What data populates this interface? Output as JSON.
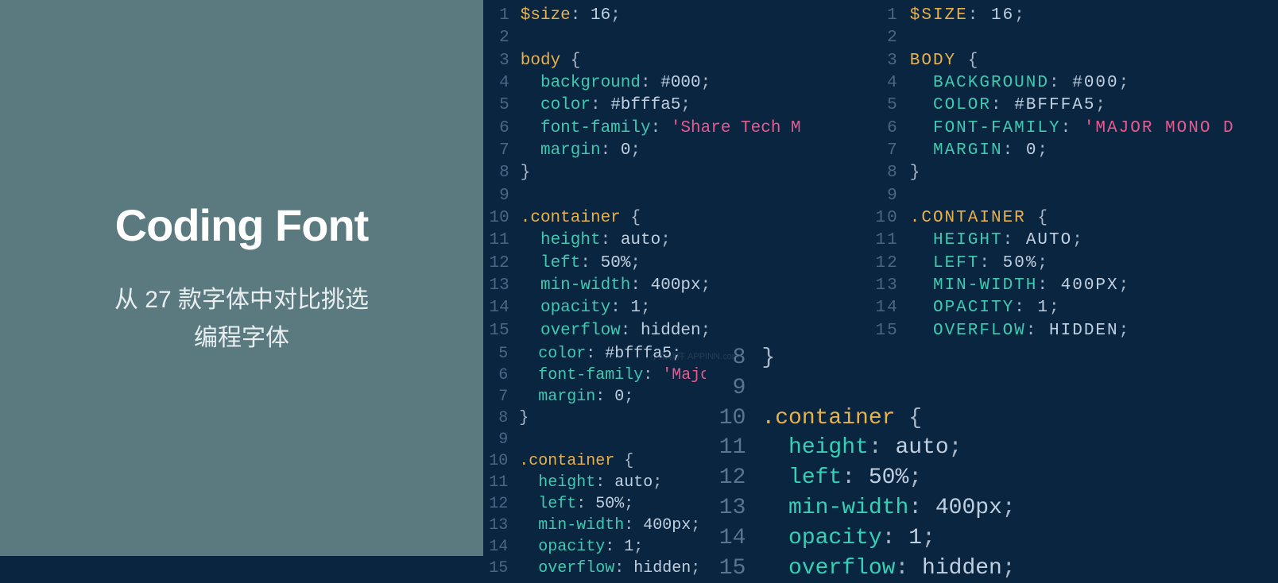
{
  "header": {
    "title": "Coding Font",
    "subtitle_line1": "从 27 款字体中对比挑选",
    "subtitle_line2": "编程字体"
  },
  "panes": {
    "a": {
      "lines": [
        {
          "n": "1",
          "t": [
            [
              "var",
              "$size"
            ],
            [
              "punc",
              ": "
            ],
            [
              "num",
              "16"
            ],
            [
              "punc",
              ";"
            ]
          ]
        },
        {
          "n": "2",
          "t": []
        },
        {
          "n": "3",
          "t": [
            [
              "var",
              "body"
            ],
            [
              "plain",
              " "
            ],
            [
              "punc",
              "{"
            ]
          ]
        },
        {
          "n": "4",
          "t": [
            [
              "plain",
              "  "
            ],
            [
              "prop",
              "background"
            ],
            [
              "punc",
              ": "
            ],
            [
              "num",
              "#000"
            ],
            [
              "punc",
              ";"
            ]
          ]
        },
        {
          "n": "5",
          "t": [
            [
              "plain",
              "  "
            ],
            [
              "prop",
              "color"
            ],
            [
              "punc",
              ": "
            ],
            [
              "num",
              "#bfffa5"
            ],
            [
              "punc",
              ";"
            ]
          ]
        },
        {
          "n": "6",
          "t": [
            [
              "plain",
              "  "
            ],
            [
              "prop",
              "font-family"
            ],
            [
              "punc",
              ": "
            ],
            [
              "str",
              "'Share Tech M"
            ]
          ]
        },
        {
          "n": "7",
          "t": [
            [
              "plain",
              "  "
            ],
            [
              "prop",
              "margin"
            ],
            [
              "punc",
              ": "
            ],
            [
              "num",
              "0"
            ],
            [
              "punc",
              ";"
            ]
          ]
        },
        {
          "n": "8",
          "t": [
            [
              "punc",
              "}"
            ]
          ]
        },
        {
          "n": "9",
          "t": []
        },
        {
          "n": "10",
          "t": [
            [
              "var",
              ".container"
            ],
            [
              "plain",
              " "
            ],
            [
              "punc",
              "{"
            ]
          ]
        },
        {
          "n": "11",
          "t": [
            [
              "plain",
              "  "
            ],
            [
              "prop",
              "height"
            ],
            [
              "punc",
              ": "
            ],
            [
              "num",
              "auto"
            ],
            [
              "punc",
              ";"
            ]
          ]
        },
        {
          "n": "12",
          "t": [
            [
              "plain",
              "  "
            ],
            [
              "prop",
              "left"
            ],
            [
              "punc",
              ": "
            ],
            [
              "num",
              "50%"
            ],
            [
              "punc",
              ";"
            ]
          ]
        },
        {
          "n": "13",
          "t": [
            [
              "plain",
              "  "
            ],
            [
              "prop",
              "min-width"
            ],
            [
              "punc",
              ": "
            ],
            [
              "num",
              "400px"
            ],
            [
              "punc",
              ";"
            ]
          ]
        },
        {
          "n": "14",
          "t": [
            [
              "plain",
              "  "
            ],
            [
              "prop",
              "opacity"
            ],
            [
              "punc",
              ": "
            ],
            [
              "num",
              "1"
            ],
            [
              "punc",
              ";"
            ]
          ]
        },
        {
          "n": "15",
          "t": [
            [
              "plain",
              "  "
            ],
            [
              "prop",
              "overflow"
            ],
            [
              "punc",
              ": "
            ],
            [
              "num",
              "hidden"
            ],
            [
              "punc",
              ";"
            ]
          ]
        }
      ]
    },
    "b": {
      "lines": [
        {
          "n": "1",
          "t": [
            [
              "var",
              "$SIZE"
            ],
            [
              "punc",
              ": "
            ],
            [
              "num",
              "16"
            ],
            [
              "punc",
              ";"
            ]
          ]
        },
        {
          "n": "2",
          "t": []
        },
        {
          "n": "3",
          "t": [
            [
              "var",
              "BODY"
            ],
            [
              "plain",
              " "
            ],
            [
              "punc",
              "{"
            ]
          ]
        },
        {
          "n": "4",
          "t": [
            [
              "plain",
              "  "
            ],
            [
              "prop",
              "BACKGROUND"
            ],
            [
              "punc",
              ": "
            ],
            [
              "num",
              "#000"
            ],
            [
              "punc",
              ";"
            ]
          ]
        },
        {
          "n": "5",
          "t": [
            [
              "plain",
              "  "
            ],
            [
              "prop",
              "COLOR"
            ],
            [
              "punc",
              ": "
            ],
            [
              "num",
              "#BFFFA5"
            ],
            [
              "punc",
              ";"
            ]
          ]
        },
        {
          "n": "6",
          "t": [
            [
              "plain",
              "  "
            ],
            [
              "prop",
              "FONT-FAMILY"
            ],
            [
              "punc",
              ": "
            ],
            [
              "str",
              "'MAJOR MONO D"
            ]
          ]
        },
        {
          "n": "7",
          "t": [
            [
              "plain",
              "  "
            ],
            [
              "prop",
              "MARGIN"
            ],
            [
              "punc",
              ": "
            ],
            [
              "num",
              "0"
            ],
            [
              "punc",
              ";"
            ]
          ]
        },
        {
          "n": "8",
          "t": [
            [
              "punc",
              "}"
            ]
          ]
        },
        {
          "n": "9",
          "t": []
        },
        {
          "n": "10",
          "t": [
            [
              "var",
              ".CONTAINER"
            ],
            [
              "plain",
              " "
            ],
            [
              "punc",
              "{"
            ]
          ]
        },
        {
          "n": "11",
          "t": [
            [
              "plain",
              "  "
            ],
            [
              "prop",
              "HEIGHT"
            ],
            [
              "punc",
              ": "
            ],
            [
              "num",
              "AUTO"
            ],
            [
              "punc",
              ";"
            ]
          ]
        },
        {
          "n": "12",
          "t": [
            [
              "plain",
              "  "
            ],
            [
              "prop",
              "LEFT"
            ],
            [
              "punc",
              ": "
            ],
            [
              "num",
              "50%"
            ],
            [
              "punc",
              ";"
            ]
          ]
        },
        {
          "n": "13",
          "t": [
            [
              "plain",
              "  "
            ],
            [
              "prop",
              "MIN-WIDTH"
            ],
            [
              "punc",
              ": "
            ],
            [
              "num",
              "400PX"
            ],
            [
              "punc",
              ";"
            ]
          ]
        },
        {
          "n": "14",
          "t": [
            [
              "plain",
              "  "
            ],
            [
              "prop",
              "OPACITY"
            ],
            [
              "punc",
              ": "
            ],
            [
              "num",
              "1"
            ],
            [
              "punc",
              ";"
            ]
          ]
        },
        {
          "n": "15",
          "t": [
            [
              "plain",
              "  "
            ],
            [
              "prop",
              "OVERFLOW"
            ],
            [
              "punc",
              ": "
            ],
            [
              "num",
              "HIDDEN"
            ],
            [
              "punc",
              ";"
            ]
          ]
        }
      ]
    },
    "c": {
      "lines": [
        {
          "n": "5",
          "t": [
            [
              "plain",
              "  "
            ],
            [
              "prop",
              "color"
            ],
            [
              "punc",
              ": "
            ],
            [
              "num",
              "#bfffa5"
            ],
            [
              "punc",
              ";"
            ]
          ]
        },
        {
          "n": "6",
          "t": [
            [
              "plain",
              "  "
            ],
            [
              "prop",
              "font-family"
            ],
            [
              "punc",
              ": "
            ],
            [
              "str",
              "'Major Mono Displa"
            ]
          ]
        },
        {
          "n": "7",
          "t": [
            [
              "plain",
              "  "
            ],
            [
              "prop",
              "margin"
            ],
            [
              "punc",
              ": "
            ],
            [
              "num",
              "0"
            ],
            [
              "punc",
              ";"
            ]
          ]
        },
        {
          "n": "8",
          "t": [
            [
              "punc",
              "}"
            ]
          ]
        },
        {
          "n": "9",
          "t": []
        },
        {
          "n": "10",
          "t": [
            [
              "var",
              ".container"
            ],
            [
              "plain",
              " "
            ],
            [
              "punc",
              "{"
            ]
          ]
        },
        {
          "n": "11",
          "t": [
            [
              "plain",
              "  "
            ],
            [
              "prop",
              "height"
            ],
            [
              "punc",
              ": "
            ],
            [
              "num",
              "auto"
            ],
            [
              "punc",
              ";"
            ]
          ]
        },
        {
          "n": "12",
          "t": [
            [
              "plain",
              "  "
            ],
            [
              "prop",
              "left"
            ],
            [
              "punc",
              ": "
            ],
            [
              "num",
              "50%"
            ],
            [
              "punc",
              ";"
            ]
          ]
        },
        {
          "n": "13",
          "t": [
            [
              "plain",
              "  "
            ],
            [
              "prop",
              "min-width"
            ],
            [
              "punc",
              ": "
            ],
            [
              "num",
              "400px"
            ],
            [
              "punc",
              ";"
            ]
          ]
        },
        {
          "n": "14",
          "t": [
            [
              "plain",
              "  "
            ],
            [
              "prop",
              "opacity"
            ],
            [
              "punc",
              ": "
            ],
            [
              "num",
              "1"
            ],
            [
              "punc",
              ";"
            ]
          ]
        },
        {
          "n": "15",
          "t": [
            [
              "plain",
              "  "
            ],
            [
              "prop",
              "overflow"
            ],
            [
              "punc",
              ": "
            ],
            [
              "num",
              "hidden"
            ],
            [
              "punc",
              ";"
            ]
          ]
        }
      ]
    },
    "d": {
      "lines": [
        {
          "n": "8",
          "t": [
            [
              "punc",
              "}"
            ]
          ]
        },
        {
          "n": "9",
          "t": []
        },
        {
          "n": "10",
          "t": [
            [
              "var",
              ".container"
            ],
            [
              "plain",
              " "
            ],
            [
              "punc",
              "{"
            ]
          ]
        },
        {
          "n": "11",
          "t": [
            [
              "plain",
              "  "
            ],
            [
              "prop",
              "height"
            ],
            [
              "punc",
              ": "
            ],
            [
              "num",
              "auto"
            ],
            [
              "punc",
              ";"
            ]
          ]
        },
        {
          "n": "12",
          "t": [
            [
              "plain",
              "  "
            ],
            [
              "prop",
              "left"
            ],
            [
              "punc",
              ": "
            ],
            [
              "num",
              "50%"
            ],
            [
              "punc",
              ";"
            ]
          ]
        },
        {
          "n": "13",
          "t": [
            [
              "plain",
              "  "
            ],
            [
              "prop",
              "min-width"
            ],
            [
              "punc",
              ": "
            ],
            [
              "num",
              "400px"
            ],
            [
              "punc",
              ";"
            ]
          ]
        },
        {
          "n": "14",
          "t": [
            [
              "plain",
              "  "
            ],
            [
              "prop",
              "opacity"
            ],
            [
              "punc",
              ": "
            ],
            [
              "num",
              "1"
            ],
            [
              "punc",
              ";"
            ]
          ]
        },
        {
          "n": "15",
          "t": [
            [
              "plain",
              "  "
            ],
            [
              "prop",
              "overflow"
            ],
            [
              "punc",
              ": "
            ],
            [
              "num",
              "hidden"
            ],
            [
              "punc",
              ";"
            ]
          ]
        }
      ]
    }
  },
  "watermark": "小众软件 APPINN.com"
}
